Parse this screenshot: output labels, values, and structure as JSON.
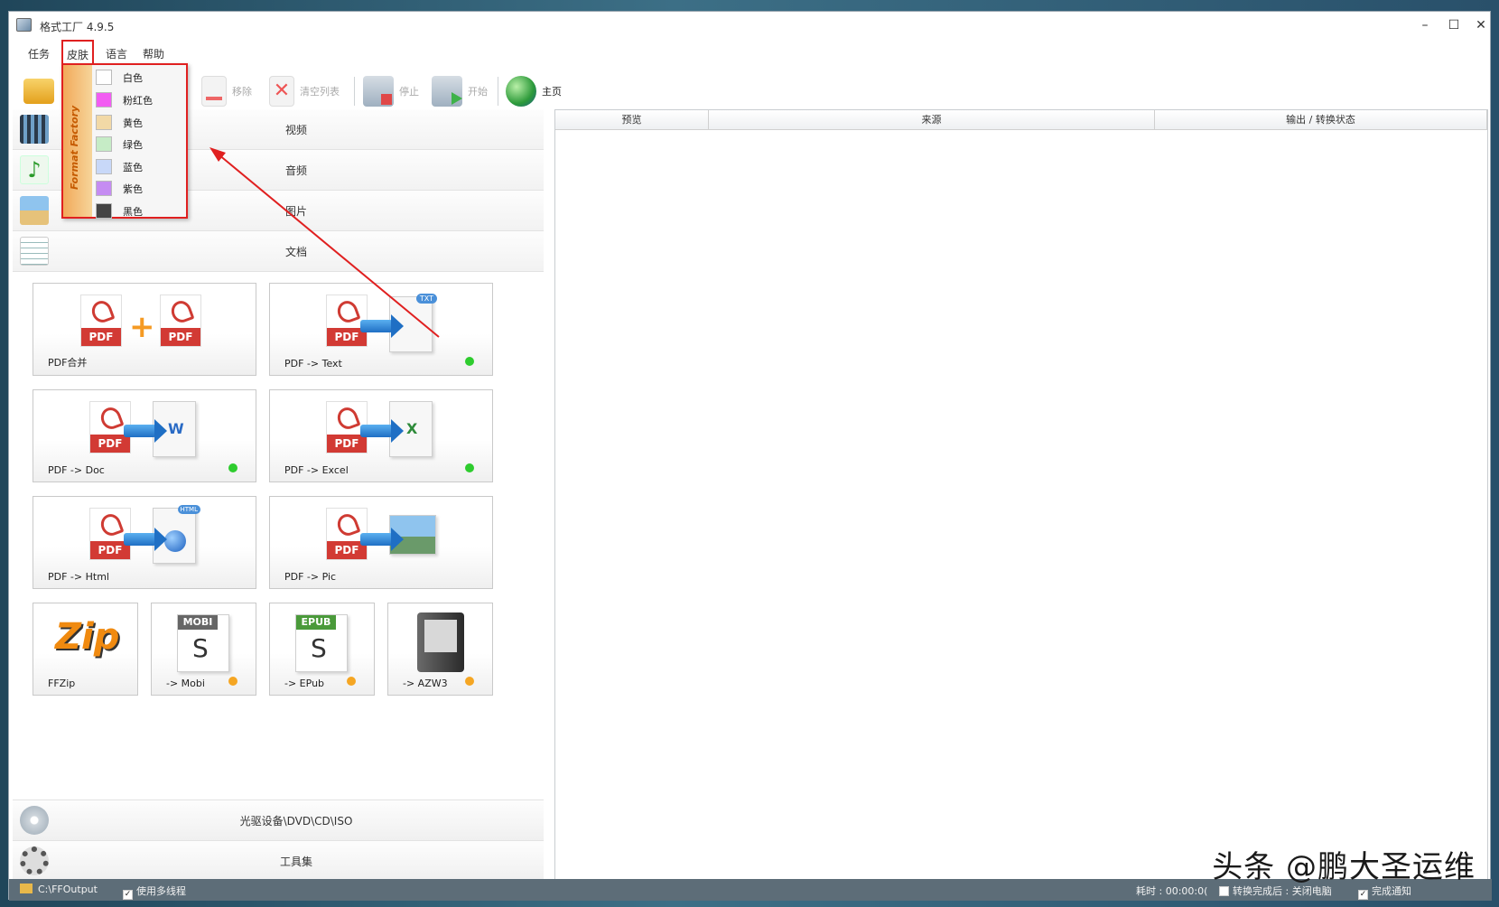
{
  "window": {
    "title": "格式工厂 4.9.5",
    "controls": {
      "minimize": "–",
      "maximize": "☐",
      "close": "✕"
    }
  },
  "menu": [
    "任务",
    "皮肤",
    "语言",
    "帮助"
  ],
  "toolbar": {
    "remove": "移除",
    "clear_list": "清空列表",
    "stop": "停止",
    "start": "开始",
    "home": "主页"
  },
  "categories": [
    "视频",
    "音频",
    "图片",
    "文档"
  ],
  "tiles": [
    {
      "label": "PDF合并"
    },
    {
      "label": "PDF -> Text"
    },
    {
      "label": "PDF -> Doc"
    },
    {
      "label": "PDF -> Excel"
    },
    {
      "label": "PDF -> Html"
    },
    {
      "label": "PDF -> Pic"
    },
    {
      "label": "FFZip"
    },
    {
      "label": "-> Mobi"
    },
    {
      "label": "-> EPub"
    },
    {
      "label": "-> AZW3"
    }
  ],
  "icon_text": {
    "pdf": "PDF",
    "txt": "TXT",
    "word": "W",
    "excel": "X",
    "html": "HTML",
    "mobi": "MOBI",
    "epub": "EPUB"
  },
  "bottom_categories": [
    "光驱设备\\DVD\\CD\\ISO",
    "工具集"
  ],
  "table_columns": [
    "预览",
    "来源",
    "输出 / 转换状态"
  ],
  "skin_menu": {
    "strip_text": "Format Factory",
    "items": [
      {
        "label": "白色",
        "color": "#ffffff"
      },
      {
        "label": "粉红色",
        "color": "#f25cf2"
      },
      {
        "label": "黄色",
        "color": "#f2d9a6"
      },
      {
        "label": "绿色",
        "color": "#c6ecc6"
      },
      {
        "label": "蓝色",
        "color": "#c8d8f8"
      },
      {
        "label": "紫色",
        "color": "#c58cf2"
      },
      {
        "label": "黑色",
        "color": "#444444"
      }
    ]
  },
  "status": {
    "output_path": "C:\\FFOutput",
    "multithread": "使用多线程",
    "elapsed": "耗时 : 00:00:0(",
    "after_convert": "转换完成后 : 关闭电脑",
    "notify": "完成通知"
  },
  "watermark_text": "头条 @鹏大圣运维",
  "watermark_bg": [
    "鹏",
    "大",
    "圣"
  ],
  "colors": {
    "dot_green": "#2ecc2e",
    "dot_orange": "#f5a623",
    "highlight_red": "#e02020"
  }
}
